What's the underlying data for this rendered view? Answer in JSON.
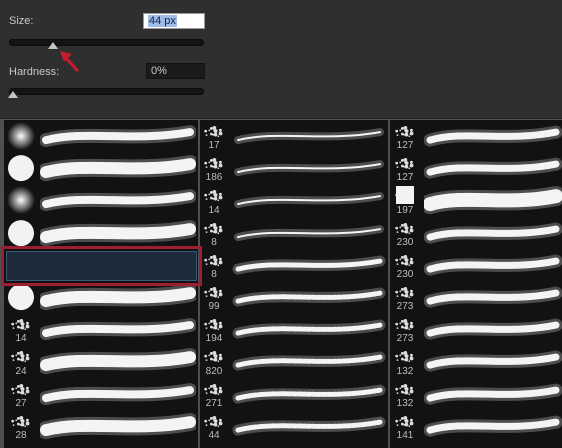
{
  "size": {
    "label": "Size:",
    "value": "44 px",
    "slider_fraction": 0.23
  },
  "hardness": {
    "label": "Hardness:",
    "value": "0%",
    "slider_fraction": 0.0
  },
  "brush_columns": [
    [
      "",
      "",
      "",
      "",
      "",
      "",
      "14",
      "24",
      "27",
      "28"
    ],
    [
      "17",
      "186",
      "14",
      "8",
      "8",
      "99",
      "194",
      "820",
      "271",
      "44"
    ],
    [
      "127",
      "127",
      "197",
      "230",
      "230",
      "273",
      "273",
      "132",
      "132",
      "141"
    ]
  ],
  "selected_brush_index": 4,
  "colors": {
    "panel": "#2f2f2f",
    "grid": "#121212",
    "selection_outline": "#9e1f32",
    "annotation_arrow": "#c81d2e"
  },
  "icons": {
    "size_arrow": "red-arrow-annotation-icon"
  }
}
